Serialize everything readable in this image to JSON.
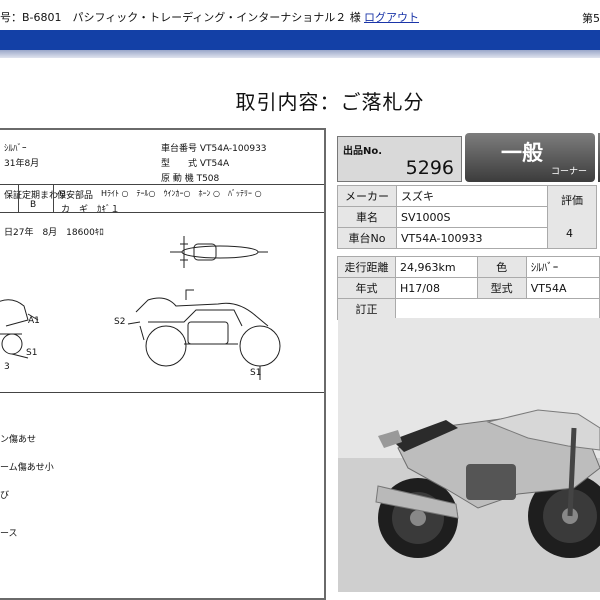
{
  "header": {
    "member_line": "号：B-6801　パシフィック・トレーディング・インターナショナル２ 様",
    "logout_label": "ログアウト",
    "right_text": "第5"
  },
  "page_title": "取引内容：ご落札分",
  "sheet": {
    "color": "ｼﾙﾊﾞｰ",
    "frame_number": "車台番号 VT54A-100933",
    "model": "型　　式 VT54A",
    "engine": "原 動 機 T508",
    "date": "31年8月",
    "col_hosho": "保証",
    "col_teishu": "定期まわり",
    "col_hokan": "保安部品",
    "val_b": "B",
    "parts_row1": "Hﾗｲﾄ ○　ﾃｰﾙ○　ｳｲﾝｶｰ○　ﾎｰﾝ ○　ﾊﾞｯﾃﾘｰ ○",
    "parts_row2": "カ　ギ　ｶｷﾞ１",
    "inspection": "日27年　8月　18600ｷﾛ",
    "label_a1": "A1",
    "label_s1_left": "S1",
    "label_s2": "S2",
    "label_s1_right": "S1",
    "label_3": "3",
    "note1": "ン傷あせ",
    "note2": "ーム傷あせ小",
    "note3": "び",
    "note4": "ース"
  },
  "lot": {
    "label": "出品No.",
    "number": "5296"
  },
  "corner": {
    "main": "一般",
    "sub": "コーナー"
  },
  "info": {
    "maker_label": "メーカー",
    "maker": "スズキ",
    "name_label": "車名",
    "name": "SV1000S",
    "frame_label": "車台No",
    "frame": "VT54A-100933",
    "rating_label": "評価",
    "rating": "4",
    "mileage_label": "走行距離",
    "mileage": "24,963km",
    "color_label": "色",
    "color": "ｼﾙﾊﾞｰ",
    "year_label": "年式",
    "year": "H17/08",
    "type_label": "型式",
    "type": "VT54A",
    "correction_label": "訂正",
    "correction": ""
  }
}
